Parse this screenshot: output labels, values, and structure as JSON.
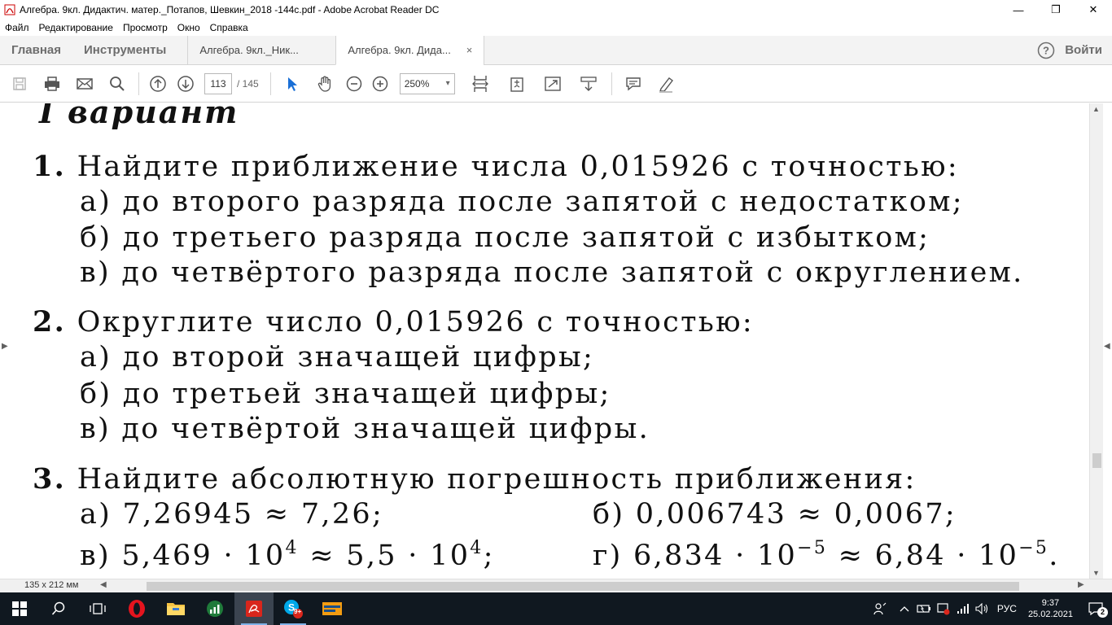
{
  "window": {
    "title": "Алгебра. 9кл. Дидактич. матер._Потапов, Шевкин_2018 -144с.pdf - Adobe Acrobat Reader DC",
    "minimize": "—",
    "restore": "❐",
    "close": "✕"
  },
  "menu": [
    "Файл",
    "Редактирование",
    "Просмотр",
    "Окно",
    "Справка"
  ],
  "tabs": {
    "home": "Главная",
    "tools": "Инструменты",
    "doc1": "Алгебра. 9кл._Ник...",
    "doc2": "Алгебра. 9кл. Дида...",
    "close": "×",
    "signin": "Войти"
  },
  "toolbar": {
    "page_current": "113",
    "page_total": "/ 145",
    "zoom": "250%",
    "zoom_caret": "▾"
  },
  "document": {
    "heading": "I вариант",
    "q1": {
      "num": "1.",
      "text": "Найдите приближение числа 0,015926 с точностью:",
      "a": "а) до второго разряда после запятой с недостатком;",
      "b": "б) до третьего разряда после запятой с избытком;",
      "c": "в) до четвёртого разряда после запятой с округлением."
    },
    "q2": {
      "num": "2.",
      "text": "Округлите число 0,015926 с точностью:",
      "a": "а) до второй значащей цифры;",
      "b": "б) до третьей значащей цифры;",
      "c": "в) до четвёртой значащей цифры."
    },
    "q3": {
      "num": "3.",
      "text": "Найдите абсолютную погрешность приближения:",
      "a": "а) 7,26945 ≈ 7,26;",
      "b": "б) 0,006743 ≈ 0,0067;",
      "c_pre": "в) 5,469 · 10",
      "c_exp": "4",
      "c_mid": " ≈ 5,5 · 10",
      "c_exp2": "4",
      "c_end": ";",
      "d_pre": "г) 6,834 · 10",
      "d_exp": "−5",
      "d_mid": " ≈ 6,84 · 10",
      "d_exp2": "−5",
      "d_end": "."
    }
  },
  "status": {
    "dims": "135 x 212 мм"
  },
  "taskbar": {
    "lang": "РУС",
    "time": "9:37",
    "date": "25.02.2021",
    "skype_badge": "9+",
    "notif_count": "2"
  }
}
